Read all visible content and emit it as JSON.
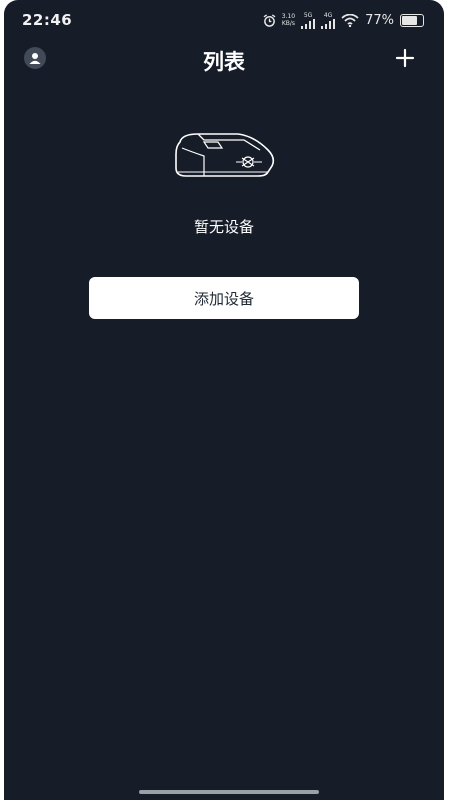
{
  "status_bar": {
    "time": "22:46",
    "net_speed_value": "3.10",
    "net_speed_unit": "KB/s",
    "sim1_label": "5G",
    "sim2_label": "4G",
    "battery": "77%",
    "battery_level": 0.77,
    "icons": [
      "alarm-icon",
      "signal-icon",
      "wifi-icon",
      "battery-icon"
    ]
  },
  "header": {
    "title": "列表",
    "left_icon": "user-icon",
    "right_icon": "plus-icon"
  },
  "empty_state": {
    "illustration": "device-icon",
    "message": "暂无设备",
    "button_label": "添加设备"
  },
  "colors": {
    "background": "#161c28",
    "button_bg": "#ffffff",
    "button_text": "#222a36",
    "text": "#ffffff"
  }
}
